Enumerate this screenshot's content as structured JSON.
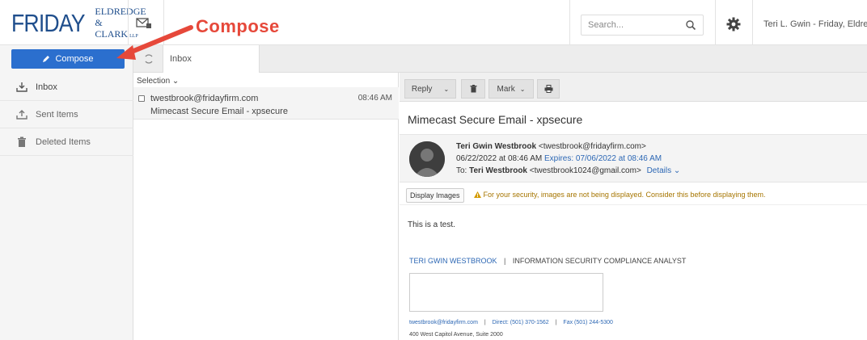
{
  "header": {
    "logo": {
      "main": "FRIDAY",
      "line1": "ELDREDGE",
      "line2": "& CLARK",
      "suffix": "LLP"
    },
    "annotation_label": "Compose",
    "search_placeholder": "Search...",
    "user_name": "Teri L. Gwin - Friday, Eldred",
    "icons": [
      "mail-icon",
      "search-icon",
      "gear-icon"
    ]
  },
  "sidebar": {
    "compose_label": "Compose",
    "items": [
      {
        "label": "Inbox",
        "icon": "inbox-icon"
      },
      {
        "label": "Sent Items",
        "icon": "sent-icon"
      },
      {
        "label": "Deleted Items",
        "icon": "trash-icon"
      }
    ]
  },
  "tabs": {
    "inbox": "Inbox"
  },
  "message_list": {
    "selection_label": "Selection ⌄",
    "messages": [
      {
        "from": "twestbrook@fridayfirm.com",
        "subject": "Mimecast Secure Email - xpsecure",
        "time": "08:46 AM"
      }
    ]
  },
  "reading_pane": {
    "toolbar": {
      "reply": "Reply",
      "mark": "Mark"
    },
    "subject": "Mimecast Secure Email - xpsecure",
    "sender_name": "Teri Gwin Westbrook",
    "sender_email": "<twestbrook@fridayfirm.com>",
    "sent_at": "06/22/2022 at 08:46 AM",
    "expires": "Expires: 07/06/2022 at 08:46 AM",
    "to_label": "To:",
    "to_name": "Teri Westbrook",
    "to_email": "<twestbrook1024@gmail.com>",
    "details": "Details ⌄",
    "display_images": "Display Images",
    "security_warning": "For your security, images are not being displayed. Consider this before displaying them.",
    "body": "This is a test.",
    "signature": {
      "name": "TERI GWIN WESTBROOK",
      "separator": "|",
      "title": "INFORMATION SECURITY COMPLIANCE ANALYST",
      "email": "twestbrook@fridayfirm.com",
      "direct": "Direct: (501) 370-1562",
      "fax": "Fax (501) 244-5300",
      "address": "400 West Capitol Avenue, Suite 2000"
    }
  },
  "colors": {
    "accent": "#2b6fce",
    "annotation": "#e6483a",
    "brand": "#1f4e8c",
    "warning": "#a67500"
  }
}
